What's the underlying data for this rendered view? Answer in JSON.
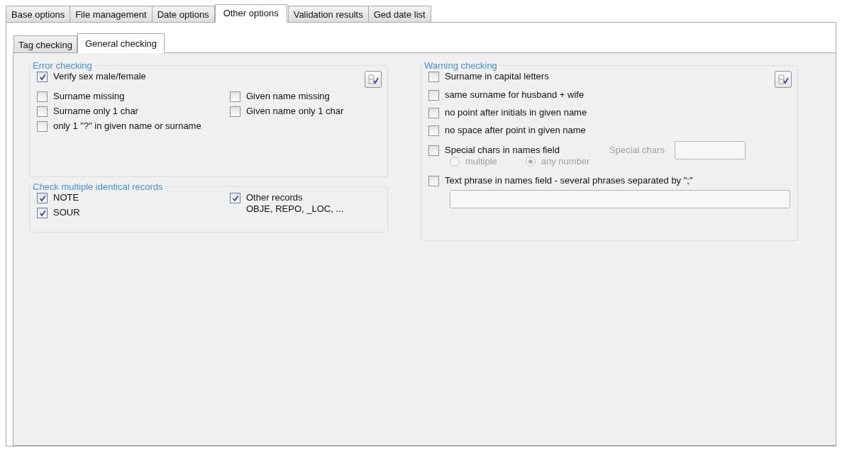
{
  "tabs": [
    {
      "label": "Base options",
      "selected": false
    },
    {
      "label": "File management",
      "selected": false
    },
    {
      "label": "Date options",
      "selected": false
    },
    {
      "label": "Other options",
      "selected": true
    },
    {
      "label": "Validation results",
      "selected": false
    },
    {
      "label": "Ged date list",
      "selected": false
    }
  ],
  "subtabs": [
    {
      "label": "Tag checking",
      "selected": false
    },
    {
      "label": "General checking",
      "selected": true
    }
  ],
  "error_checking": {
    "title": "Error checking",
    "rows": [
      [
        {
          "label": "Verify sex male/female",
          "checked": true
        }
      ],
      [
        {
          "label": "Surname missing",
          "checked": false
        },
        {
          "label": "Given name missing",
          "checked": false
        }
      ],
      [
        {
          "label": "Surname only 1 char",
          "checked": false
        },
        {
          "label": "Given name only 1 char",
          "checked": false
        }
      ],
      [
        {
          "label": "only 1 \"?\" in given name or surname",
          "checked": false
        }
      ]
    ]
  },
  "multiple_records": {
    "title": "Check multiple identical records",
    "left": [
      {
        "label": "NOTE",
        "checked": true
      },
      {
        "label": "SOUR",
        "checked": true
      }
    ],
    "right": {
      "label": "Other records",
      "sublabel": "OBJE, REPO, _LOC, ...",
      "checked": true
    }
  },
  "warning_checking": {
    "title": "Warning checking",
    "items": [
      {
        "label": "Surname in capital letters",
        "checked": false
      },
      {
        "label": "same surname for husband + wife",
        "checked": false
      },
      {
        "label": "no point after initials in given name",
        "checked": false
      },
      {
        "label": "no space after point in given name",
        "checked": false
      }
    ],
    "special": {
      "label": "Special chars in names field",
      "checked": false,
      "field_label": "Special chars",
      "disabled": true,
      "radios": [
        {
          "label": "multiple",
          "selected": false
        },
        {
          "label": "any number",
          "selected": true
        }
      ]
    },
    "phrase": {
      "label": "Text phrase in names field - several phrases separated by \";\"",
      "checked": false
    }
  }
}
